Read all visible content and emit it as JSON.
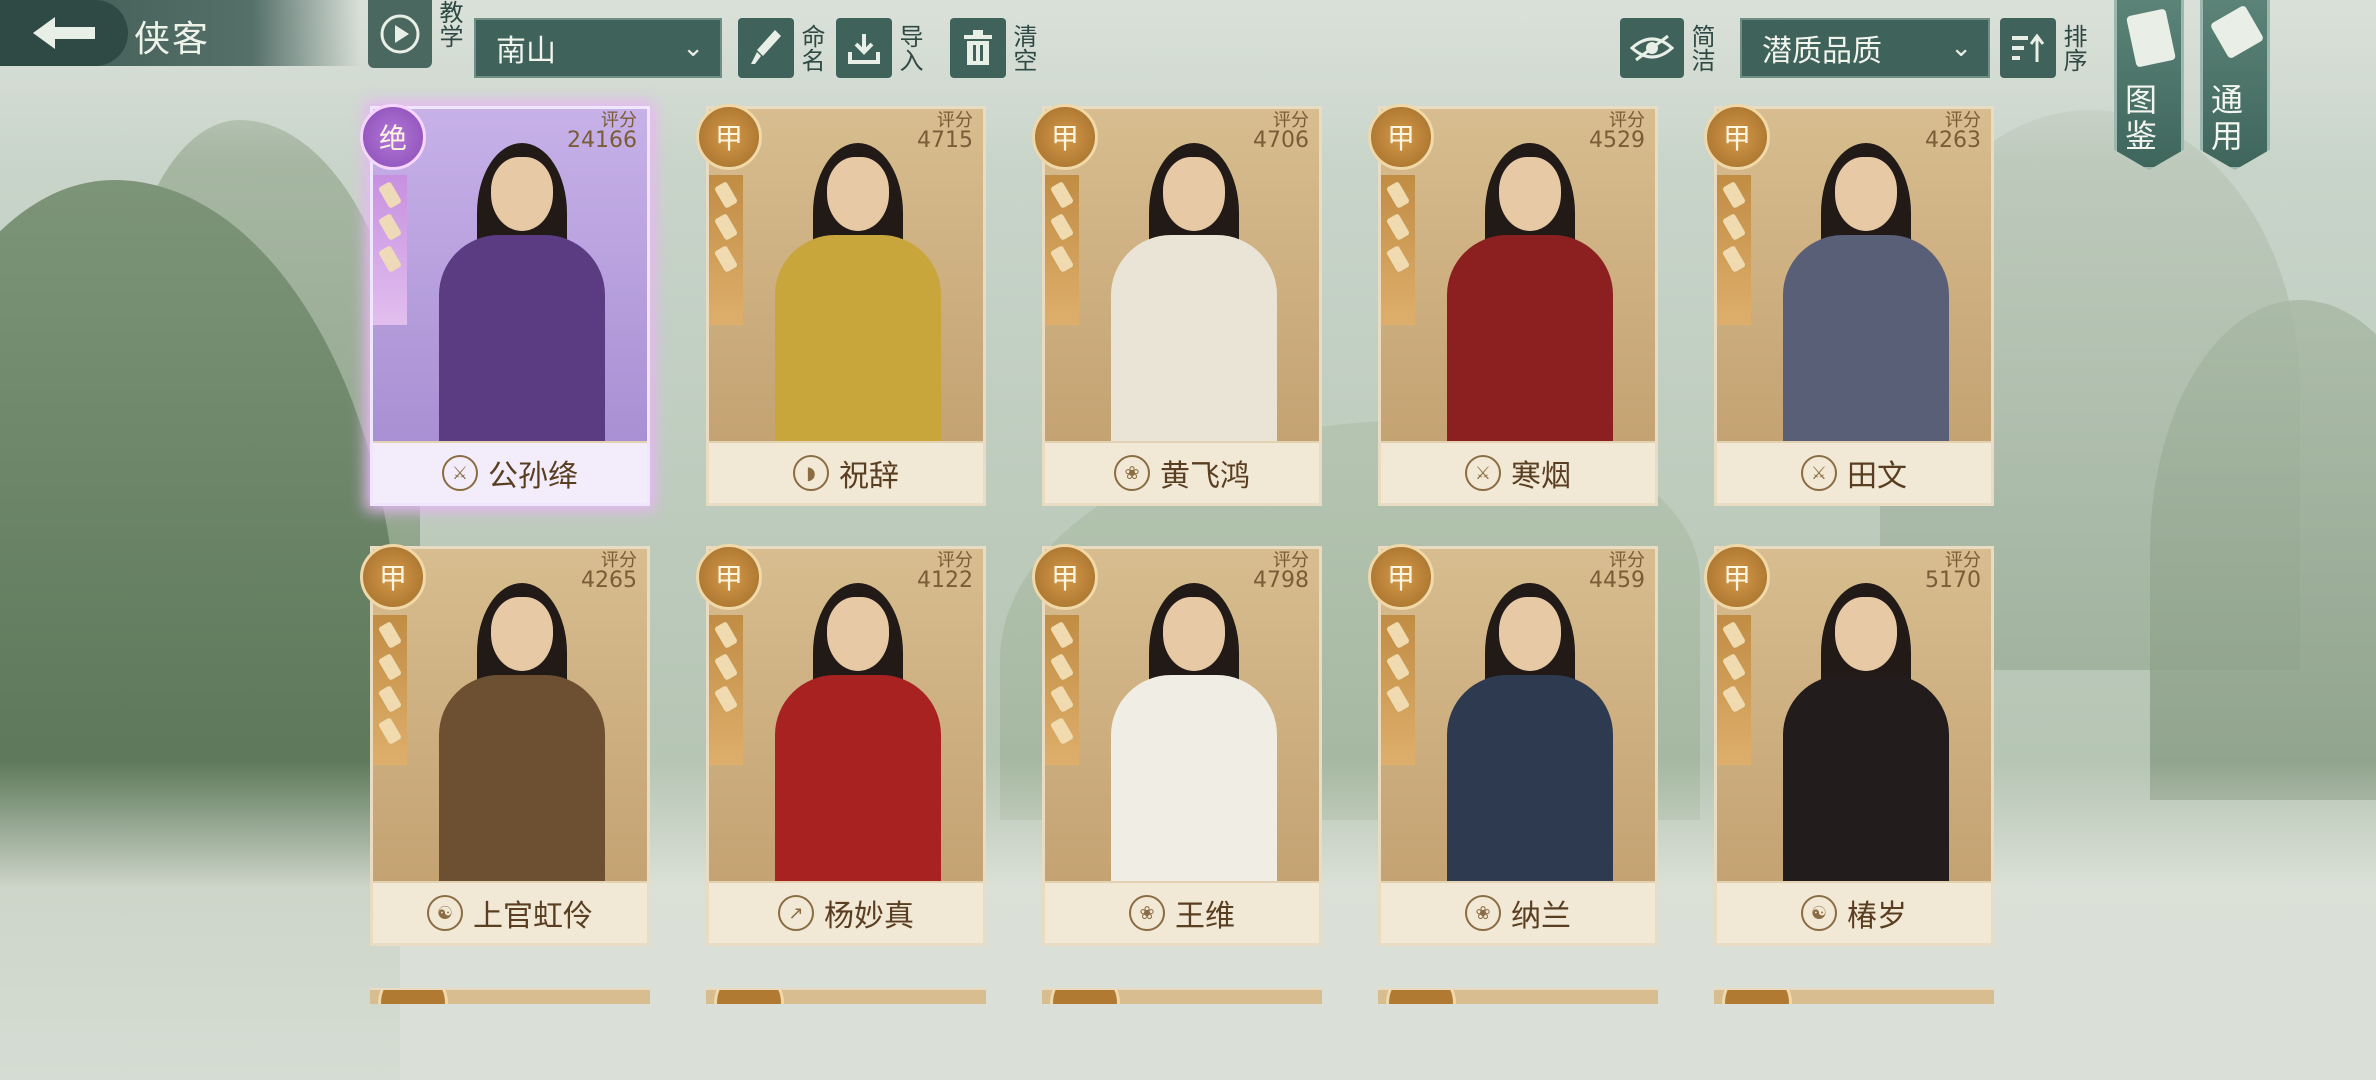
{
  "header": {
    "title": "侠客",
    "tutorial_label": "教学",
    "team_select": "南山",
    "rename_label": "命名",
    "import_label": "导入",
    "clear_label": "清空",
    "simple_label": "简洁",
    "sort_select": "潜质品质",
    "sort_label": "排序"
  },
  "side_tabs": [
    {
      "label": "图鉴",
      "icon": "album-icon"
    },
    {
      "label": "通用",
      "icon": "scroll-icon"
    }
  ],
  "score_label": "评分",
  "heroes": [
    {
      "name": "公孙绛",
      "grade": "绝",
      "score": "24166",
      "sect_icon": "sword-icon",
      "rarity": "purple",
      "outfit": "#5b3c83",
      "ribs": 3
    },
    {
      "name": "祝辞",
      "grade": "甲",
      "score": "4715",
      "sect_icon": "shield-icon",
      "rarity": "gold",
      "outfit": "#c9a63c",
      "ribs": 3
    },
    {
      "name": "黄飞鸿",
      "grade": "甲",
      "score": "4706",
      "sect_icon": "lotus-icon",
      "rarity": "gold",
      "outfit": "#e9e4d6",
      "ribs": 3
    },
    {
      "name": "寒烟",
      "grade": "甲",
      "score": "4529",
      "sect_icon": "sword-icon",
      "rarity": "gold",
      "outfit": "#8c1f1f",
      "ribs": 3
    },
    {
      "name": "田文",
      "grade": "甲",
      "score": "4263",
      "sect_icon": "sword-icon",
      "rarity": "gold",
      "outfit": "#5a5f78",
      "ribs": 3
    },
    {
      "name": "上官虹伶",
      "grade": "甲",
      "score": "4265",
      "sect_icon": "yin-yang-icon",
      "rarity": "gold",
      "outfit": "#6d5032",
      "ribs": 4
    },
    {
      "name": "杨妙真",
      "grade": "甲",
      "score": "4122",
      "sect_icon": "spear-icon",
      "rarity": "gold",
      "outfit": "#a82222",
      "ribs": 3
    },
    {
      "name": "王维",
      "grade": "甲",
      "score": "4798",
      "sect_icon": "lotus-icon",
      "rarity": "gold",
      "outfit": "#f0ede4",
      "ribs": 4
    },
    {
      "name": "纳兰",
      "grade": "甲",
      "score": "4459",
      "sect_icon": "lotus-icon",
      "rarity": "gold",
      "outfit": "#2e3a4f",
      "ribs": 3
    },
    {
      "name": "椿岁",
      "grade": "甲",
      "score": "5170",
      "sect_icon": "yin-yang-icon",
      "rarity": "gold",
      "outfit": "#221c1c",
      "ribs": 3
    }
  ]
}
